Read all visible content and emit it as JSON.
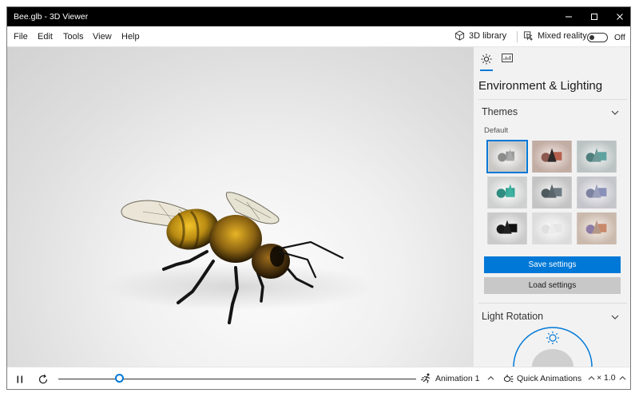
{
  "window": {
    "title": "Bee.glb - 3D Viewer"
  },
  "menu": {
    "items": [
      {
        "label": "File"
      },
      {
        "label": "Edit"
      },
      {
        "label": "Tools"
      },
      {
        "label": "View"
      },
      {
        "label": "Help"
      }
    ],
    "library_label": "3D library",
    "mixed_reality_label": "Mixed reality",
    "mixed_reality_state": "Off"
  },
  "panel": {
    "heading": "Environment & Lighting",
    "themes_title": "Themes",
    "default_label": "Default",
    "selected_theme_index": 0,
    "save_label": "Save settings",
    "load_label": "Load settings",
    "light_rotation_title": "Light Rotation"
  },
  "bottom": {
    "animation_label": "Animation 1",
    "quick_animations_label": "Quick Animations",
    "speed": "× 1.0",
    "timeline_progress": 0.17
  },
  "colors": {
    "accent": "#0078d7",
    "titlebar": "#000000",
    "panel_bg": "#f2f2f2"
  }
}
